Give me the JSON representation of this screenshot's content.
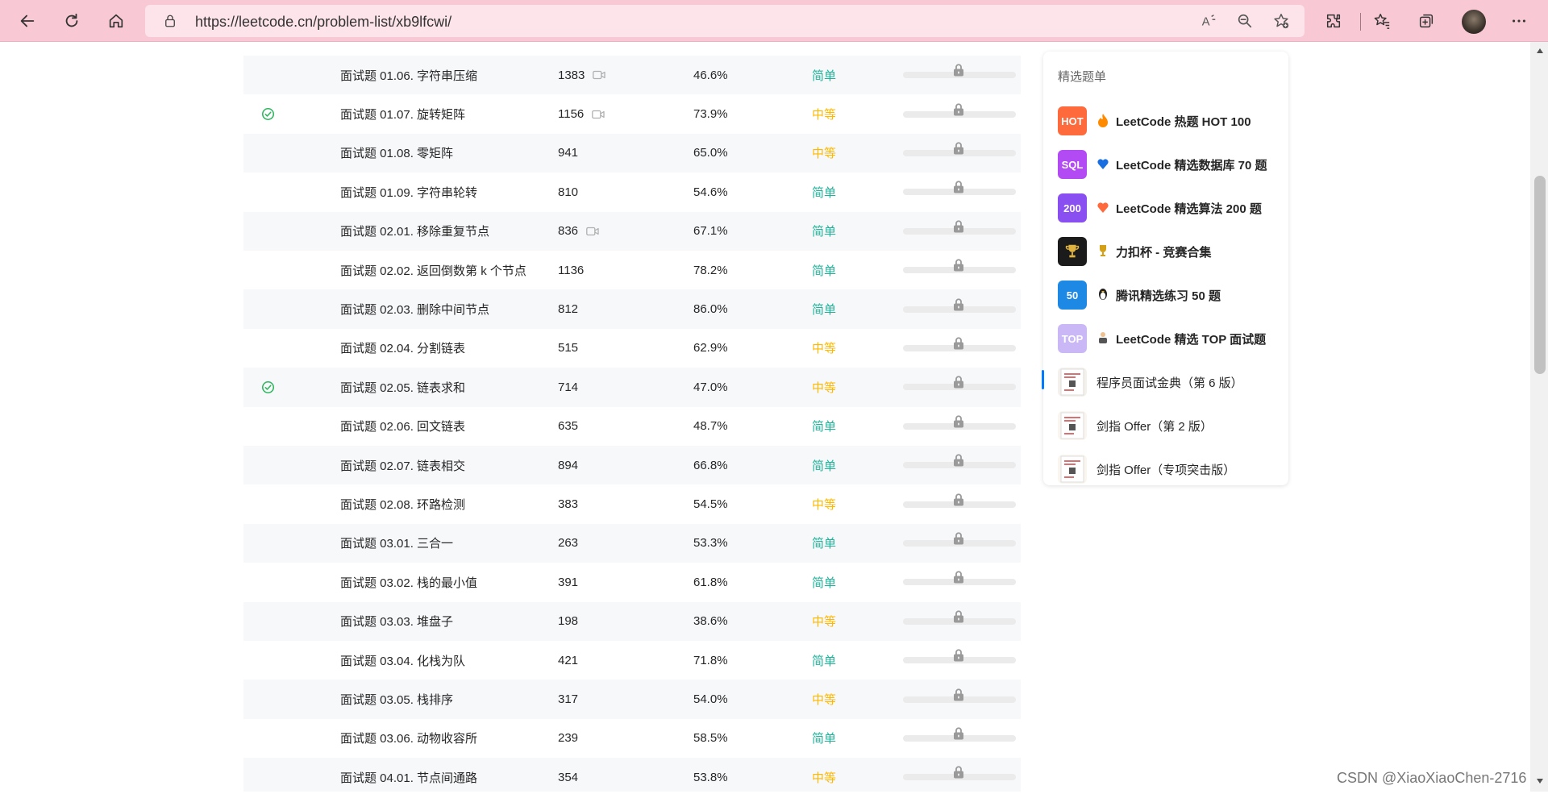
{
  "browser": {
    "url": "https://leetcode.cn/problem-list/xb9lfcwi/"
  },
  "problems": [
    {
      "title": "面试题 01.06. 字符串压缩",
      "solutions": "1383",
      "video": true,
      "rate": "46.6%",
      "difficulty": "简单",
      "diff_class": "easy",
      "solved": false
    },
    {
      "title": "面试题 01.07. 旋转矩阵",
      "solutions": "1156",
      "video": true,
      "rate": "73.9%",
      "difficulty": "中等",
      "diff_class": "medium",
      "solved": true
    },
    {
      "title": "面试题 01.08. 零矩阵",
      "solutions": "941",
      "video": false,
      "rate": "65.0%",
      "difficulty": "中等",
      "diff_class": "medium",
      "solved": false
    },
    {
      "title": "面试题 01.09. 字符串轮转",
      "solutions": "810",
      "video": false,
      "rate": "54.6%",
      "difficulty": "简单",
      "diff_class": "easy",
      "solved": false
    },
    {
      "title": "面试题 02.01. 移除重复节点",
      "solutions": "836",
      "video": true,
      "rate": "67.1%",
      "difficulty": "简单",
      "diff_class": "easy",
      "solved": false
    },
    {
      "title": "面试题 02.02. 返回倒数第 k 个节点",
      "solutions": "1136",
      "video": false,
      "rate": "78.2%",
      "difficulty": "简单",
      "diff_class": "easy",
      "solved": false
    },
    {
      "title": "面试题 02.03. 删除中间节点",
      "solutions": "812",
      "video": false,
      "rate": "86.0%",
      "difficulty": "简单",
      "diff_class": "easy",
      "solved": false
    },
    {
      "title": "面试题 02.04. 分割链表",
      "solutions": "515",
      "video": false,
      "rate": "62.9%",
      "difficulty": "中等",
      "diff_class": "medium",
      "solved": false
    },
    {
      "title": "面试题 02.05. 链表求和",
      "solutions": "714",
      "video": false,
      "rate": "47.0%",
      "difficulty": "中等",
      "diff_class": "medium",
      "solved": true
    },
    {
      "title": "面试题 02.06. 回文链表",
      "solutions": "635",
      "video": false,
      "rate": "48.7%",
      "difficulty": "简单",
      "diff_class": "easy",
      "solved": false
    },
    {
      "title": "面试题 02.07. 链表相交",
      "solutions": "894",
      "video": false,
      "rate": "66.8%",
      "difficulty": "简单",
      "diff_class": "easy",
      "solved": false
    },
    {
      "title": "面试题 02.08. 环路检测",
      "solutions": "383",
      "video": false,
      "rate": "54.5%",
      "difficulty": "中等",
      "diff_class": "medium",
      "solved": false
    },
    {
      "title": "面试题 03.01. 三合一",
      "solutions": "263",
      "video": false,
      "rate": "53.3%",
      "difficulty": "简单",
      "diff_class": "easy",
      "solved": false
    },
    {
      "title": "面试题 03.02. 栈的最小值",
      "solutions": "391",
      "video": false,
      "rate": "61.8%",
      "difficulty": "简单",
      "diff_class": "easy",
      "solved": false
    },
    {
      "title": "面试题 03.03. 堆盘子",
      "solutions": "198",
      "video": false,
      "rate": "38.6%",
      "difficulty": "中等",
      "diff_class": "medium",
      "solved": false
    },
    {
      "title": "面试题 03.04. 化栈为队",
      "solutions": "421",
      "video": false,
      "rate": "71.8%",
      "difficulty": "简单",
      "diff_class": "easy",
      "solved": false
    },
    {
      "title": "面试题 03.05. 栈排序",
      "solutions": "317",
      "video": false,
      "rate": "54.0%",
      "difficulty": "中等",
      "diff_class": "medium",
      "solved": false
    },
    {
      "title": "面试题 03.06. 动物收容所",
      "solutions": "239",
      "video": false,
      "rate": "58.5%",
      "difficulty": "简单",
      "diff_class": "easy",
      "solved": false
    },
    {
      "title": "面试题 04.01. 节点间通路",
      "solutions": "354",
      "video": false,
      "rate": "53.8%",
      "difficulty": "中等",
      "diff_class": "medium",
      "solved": false
    }
  ],
  "sidebar": {
    "title": "精选题单",
    "items": [
      {
        "label": "LeetCode 热题 HOT 100",
        "thumb_text": "HOT",
        "thumb_color": "#ff6a3d",
        "emoji_color": "#ff8a00",
        "bold": true
      },
      {
        "label": "LeetCode 精选数据库 70 题",
        "thumb_text": "SQL",
        "thumb_color": "#b24bf3",
        "emoji_color": "#1a6fe0",
        "bold": true
      },
      {
        "label": "LeetCode 精选算法 200 题",
        "thumb_text": "200",
        "thumb_color": "#8a4ff0",
        "emoji_color": "#ff6a3d",
        "bold": true
      },
      {
        "label": "力扣杯 - 竞赛合集",
        "thumb_text": "",
        "thumb_color": "#1b1b1b",
        "emoji_color": "#d4a017",
        "bold": true
      },
      {
        "label": "腾讯精选练习 50 题",
        "thumb_text": "50",
        "thumb_color": "#1e88e5",
        "emoji_color": "#222222",
        "bold": true
      },
      {
        "label": "LeetCode 精选 TOP 面试题",
        "thumb_text": "TOP",
        "thumb_color": "#c9b8f5",
        "emoji_color": "#555555",
        "bold": true
      },
      {
        "label": "程序员面试金典（第 6 版）",
        "thumb_text": "",
        "thumb_color": "#f4f1ec",
        "emoji_color": "",
        "bold": false,
        "active": true
      },
      {
        "label": "剑指 Offer（第 2 版）",
        "thumb_text": "",
        "thumb_color": "#faf6ef",
        "emoji_color": "",
        "bold": false
      },
      {
        "label": "剑指 Offer（专项突击版）",
        "thumb_text": "",
        "thumb_color": "#faf6ef",
        "emoji_color": "",
        "bold": false
      }
    ]
  },
  "watermark": "CSDN @XiaoXiaoChen-2716",
  "colors": {
    "easy": "#1fb299",
    "medium": "#ffb800",
    "solved": "#2db55d",
    "accent": "#007aff"
  }
}
